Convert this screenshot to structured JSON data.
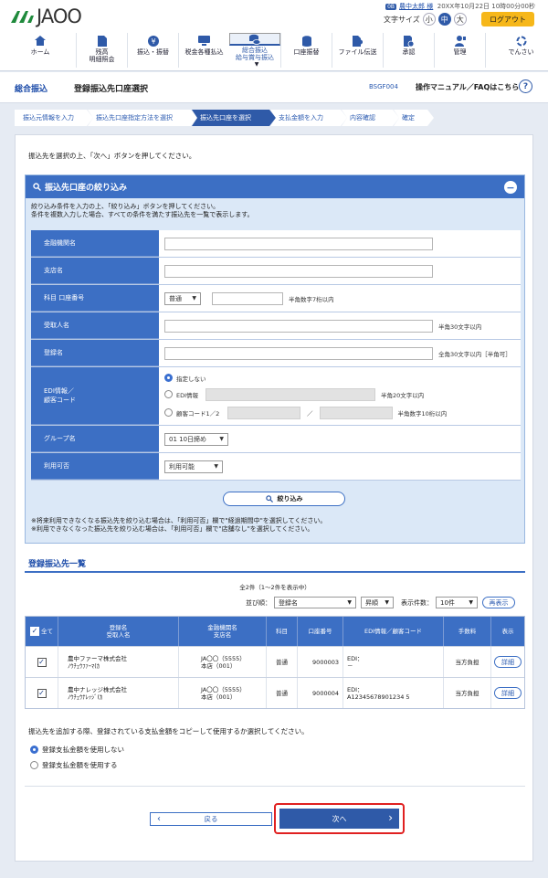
{
  "header": {
    "logo": "JAOO",
    "user_badge": "0B",
    "user_name": "農中太郎 様",
    "datetime": "20XX年10月22日 10時00分00秒",
    "font_size_label": "文字サイズ",
    "font_sizes": [
      "小",
      "中",
      "大"
    ],
    "logout": "ログアウト"
  },
  "nav": [
    {
      "label": "ホーム",
      "icon": "home-icon"
    },
    {
      "label": "残高\n明細照会",
      "icon": "document-icon"
    },
    {
      "label": "振込・振替",
      "icon": "yen-icon"
    },
    {
      "label": "税金各種払込",
      "icon": "monitor-icon"
    },
    {
      "label": "総合振込\n給与賞与振込",
      "icon": "coins-icon"
    },
    {
      "label": "口座振替",
      "icon": "coins-stack-icon"
    },
    {
      "label": "ファイル伝送",
      "icon": "file-transfer-icon"
    },
    {
      "label": "承認",
      "icon": "approval-icon"
    },
    {
      "label": "管理",
      "icon": "admin-icon"
    },
    {
      "label": "でんさい",
      "icon": "densai-icon"
    }
  ],
  "subheader": {
    "section": "総合振込",
    "title": "登録振込先口座選択",
    "code": "BSGF004",
    "help": "操作マニュアル／FAQはこちら"
  },
  "steps": [
    "振込元情報を入力",
    "振込先口座指定方法を選択",
    "振込先口座を選択",
    "支払金額を入力",
    "内容確認",
    "確定"
  ],
  "instruction": "振込先を選択の上、「次へ」ボタンを押してください。",
  "filter": {
    "title": "振込先口座の絞り込み",
    "desc1": "絞り込み条件を入力の上、「絞り込み」ボタンを押してください。",
    "desc2": "条件を複数入力した場合、すべての条件を満たす振込先を一覧で表示します。",
    "labels": {
      "bank": "金融機関名",
      "branch": "支店名",
      "account": "科目 口座番号",
      "payee": "受取人名",
      "reg": "登録名",
      "edi": "EDI情報／\n顧客コード",
      "group": "グループ名",
      "avail": "利用可否"
    },
    "account_type": "普通",
    "hint_account": "半角数字7桁以内",
    "hint_payee": "半角30文字以内",
    "hint_reg": "全角30文字以内［半角可］",
    "edi_opts": [
      "指定しない",
      "EDI情報",
      "顧客コード1／2"
    ],
    "hint_edi": "半角20文字以内",
    "hint_cust": "半角数字10桁以内",
    "slash": "／",
    "group": "01 10日締め",
    "avail": "利用可能",
    "search_btn": "絞り込み",
    "note1": "※将来利用できなくなる振込先を絞り込む場合は、「利用可否」欄で\"経過期間中\"を選択してください。",
    "note2": "※利用できなくなった振込先を絞り込む場合は、「利用可否」欄で\"店舗なし\"を選択してください。"
  },
  "list": {
    "title": "登録振込先一覧",
    "count": "全2件（1～2件を表示中）",
    "sort_label": "並び順：",
    "sort_value": "登録名",
    "order_value": "昇順",
    "per_label": "表示件数：",
    "per_value": "10件",
    "redisplay": "再表示",
    "headers": {
      "all": "全て",
      "name": "登録名\n受取人名",
      "bank": "金融機関名\n支店名",
      "type": "科目",
      "acct": "口座番号",
      "edi": "EDI情報／顧客コード",
      "fee": "手数料",
      "view": "表示"
    },
    "rows": [
      {
        "name": "農中ファーマ株式会社",
        "kana": "ﾉｳﾁｭｳﾌｧｰﾏ(ｶ",
        "bank": "JA〇〇（5555）",
        "branch": "本店（001）",
        "type": "普通",
        "acct": "9000003",
        "edi": "EDI：",
        "edi2": "－",
        "fee": "当方負担",
        "detail": "詳細"
      },
      {
        "name": "農中ナレッジ株式会社",
        "kana": "ﾉｳﾁｭｳﾅﾚｯｼﾞ(ｶ",
        "bank": "JA〇〇（5555）",
        "branch": "本店（001）",
        "type": "普通",
        "acct": "9000004",
        "edi": "EDI：",
        "edi2": "A12345678901234 5",
        "fee": "当方負担",
        "detail": "詳細"
      }
    ]
  },
  "copy_question": "振込先を追加する際、登録されている支払金額をコピーして使用するか選択してください。",
  "copy_opts": [
    "登録支払金額を使用しない",
    "登録支払金額を使用する"
  ],
  "back_btn": "戻る",
  "next_btn": "次へ"
}
